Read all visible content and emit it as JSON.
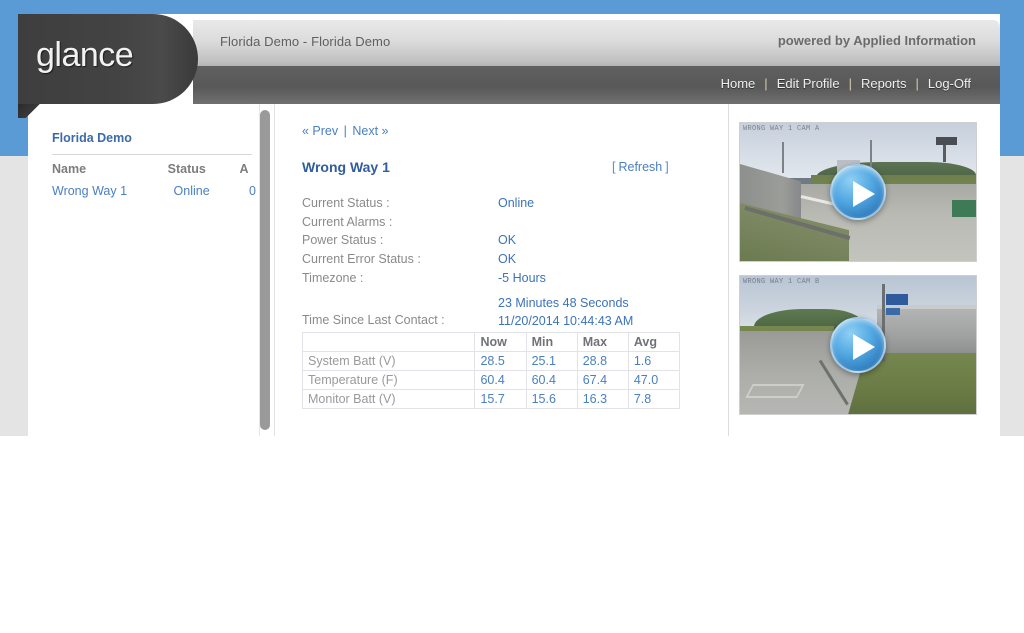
{
  "branding": {
    "logo_text": "glance",
    "powered_by": "powered by Applied Information",
    "accent_blue": "#5b9bd5",
    "link_blue": "#4a7fc1"
  },
  "header": {
    "title": "Florida Demo - Florida Demo"
  },
  "nav": {
    "items": [
      {
        "label": "Home"
      },
      {
        "label": "Edit Profile"
      },
      {
        "label": "Reports"
      },
      {
        "label": "Log-Off"
      }
    ],
    "separator": "|"
  },
  "sidebar": {
    "title": "Florida Demo",
    "columns": [
      "Name",
      "Status",
      "A"
    ],
    "rows": [
      {
        "name": "Wrong Way 1",
        "status": "Online",
        "a": "0"
      }
    ]
  },
  "main": {
    "prev_label": "« Prev",
    "next_label": "Next »",
    "pager_separator": "|",
    "device_title": "Wrong Way 1",
    "refresh_open": "[",
    "refresh_label": "Refresh",
    "refresh_close": "]",
    "status_fields": [
      {
        "label": "Current Status :",
        "value": "Online"
      },
      {
        "label": "Current Alarms :",
        "value": ""
      },
      {
        "label": "Power Status :",
        "value": "OK"
      },
      {
        "label": "Current Error Status :",
        "value": "OK"
      },
      {
        "label": "Timezone :",
        "value": "-5 Hours"
      }
    ],
    "last_contact": {
      "label": "Time Since Last Contact :",
      "elapsed": "23 Minutes 48 Seconds",
      "timestamp": "11/20/2014 10:44:43 AM"
    },
    "metrics": {
      "headers": [
        "",
        "Now",
        "Min",
        "Max",
        "Avg"
      ],
      "rows": [
        {
          "name": "System Batt (V)",
          "now": "28.5",
          "min": "25.1",
          "max": "28.8",
          "avg": "1.6"
        },
        {
          "name": "Temperature (F)",
          "now": "60.4",
          "min": "60.4",
          "max": "67.4",
          "avg": "47.0"
        },
        {
          "name": "Monitor Batt (V)",
          "now": "15.7",
          "min": "15.6",
          "max": "16.3",
          "avg": "7.8"
        }
      ]
    }
  },
  "videos": [
    {
      "name": "camera-1",
      "timestamp_overlay": "WRONG WAY 1 CAM A",
      "play_label": "play-icon"
    },
    {
      "name": "camera-2",
      "timestamp_overlay": "WRONG WAY 1 CAM B",
      "play_label": "play-icon"
    }
  ]
}
